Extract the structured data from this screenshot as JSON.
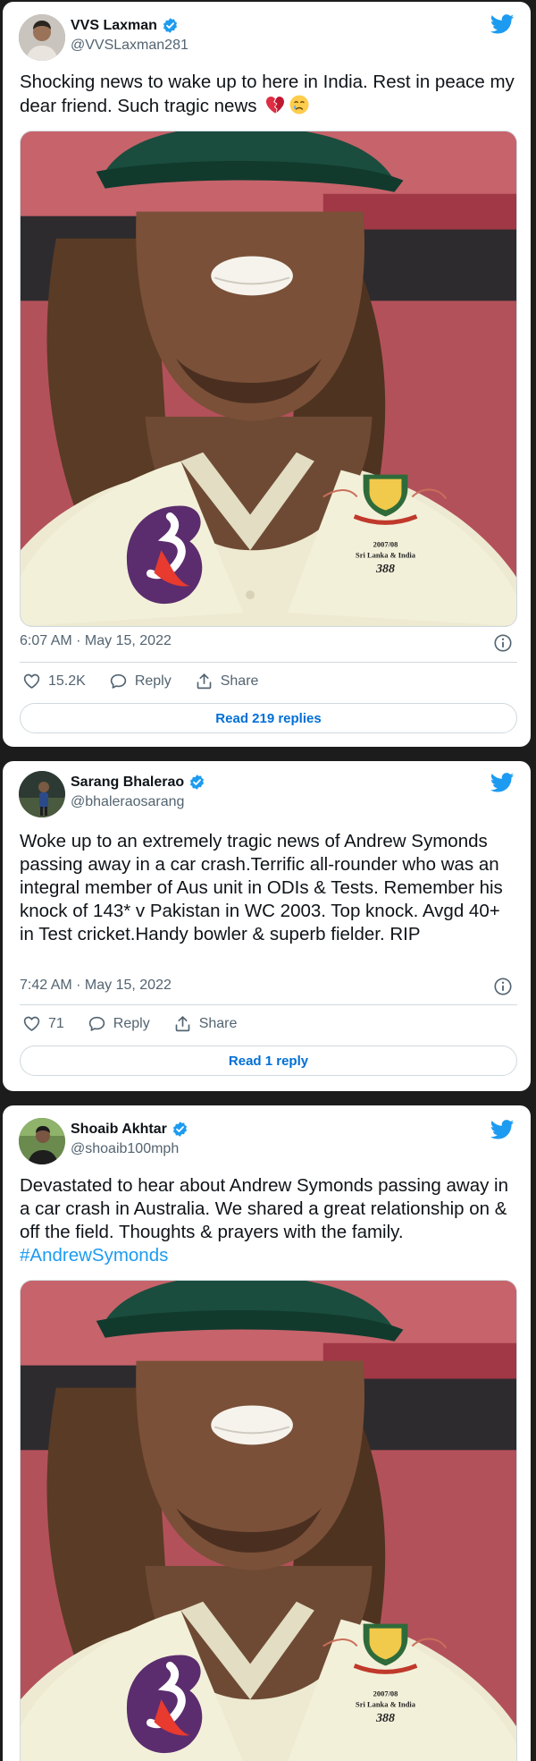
{
  "tweets": [
    {
      "name": "VVS Laxman",
      "handle": "@VVSLaxman281",
      "text": "Shocking news to wake up to here in India. Rest in peace my dear friend. Such tragic news",
      "emojis": [
        "broken-heart-emoji",
        "crying-face-emoji"
      ],
      "timestamp": "6:07 AM · May 15, 2022",
      "likes": "15.2K",
      "reply_label": "Reply",
      "share_label": "Share",
      "read_replies": "Read 219 replies"
    },
    {
      "name": "Sarang Bhalerao",
      "handle": "@bhaleraosarang",
      "text": "Woke up to an extremely tragic news of Andrew Symonds passing away in a car crash.Terrific all-rounder who was an integral member of Aus unit in ODIs & Tests. Remember his knock of 143* v Pakistan in WC 2003. Top knock. Avgd 40+ in Test cricket.Handy bowler & superb fielder. RIP",
      "timestamp": "7:42 AM · May 15, 2022",
      "likes": "71",
      "reply_label": "Reply",
      "share_label": "Share",
      "read_replies": "Read 1 reply"
    },
    {
      "name": "Shoaib Akhtar",
      "handle": "@shoaib100mph",
      "text": "Devastated to hear about Andrew Symonds passing away in a car crash in Australia. We shared a great relationship on & off the field. Thoughts & prayers with the family.",
      "hashtag": "#AndrewSymonds"
    }
  ],
  "photo": {
    "jersey_logo": "3",
    "badge_line1": "2007/08",
    "badge_line2": "Sri Lanka & India",
    "badge_number": "388"
  },
  "colors": {
    "accent": "#1d9bf0",
    "link": "#006fd6",
    "text": "#0f1419",
    "muted": "#536471",
    "border": "#cfd9de",
    "background": "#1c1c1c"
  },
  "icons": [
    "twitter-bird-icon",
    "verified-badge-icon",
    "info-icon",
    "heart-icon",
    "reply-icon",
    "share-icon"
  ]
}
